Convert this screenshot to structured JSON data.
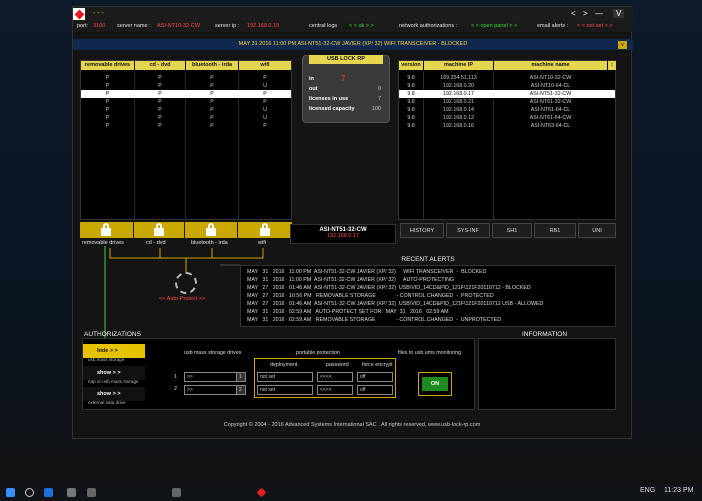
{
  "app": {
    "dots": "- - -",
    "nav_left": "<",
    "nav_right": ">",
    "minimize": "—",
    "menu": "V"
  },
  "status": {
    "port_label": "port:",
    "port": "3100",
    "server_name_label": "server name :",
    "server_name": "ASI-NT10-32-CW",
    "server_ip_label": "server ip :",
    "server_ip": "192.168.0.19",
    "central_logs_label": "central logs",
    "central_logs_value": "< < ok > >",
    "network_auth_label": "network authorizations :",
    "network_auth_value": "< < open panel > >",
    "email_label": "email alerts :",
    "email_value": "< < not set > >"
  },
  "banner": {
    "text": "MAY   31   2016   11:00 PM   ASI-NT51-32-CW JAVIER (XP/ 32)   WIFI TRANSCEIVER  -  BLOCKED",
    "button": "v"
  },
  "devices": {
    "headers": [
      "removable drives",
      "cd - dvd",
      "bluetooth - irda",
      "wifi"
    ],
    "rows": [
      [
        "P",
        "P",
        "P",
        "P"
      ],
      [
        "P",
        "P",
        "P",
        "U"
      ],
      [
        "P",
        "P",
        "P",
        "P"
      ],
      [
        "P",
        "P",
        "P",
        "P"
      ],
      [
        "P",
        "P",
        "P",
        "U"
      ],
      [
        "P",
        "P",
        "P",
        "U"
      ],
      [
        "P",
        "P",
        "P",
        "P"
      ]
    ],
    "selected_row": 2,
    "lock_labels": [
      "removable drives",
      "cd - dvd",
      "bluetooth - irda",
      "wifi"
    ]
  },
  "usb_panel": {
    "title": "USB LOCK RP",
    "in_label": "in",
    "in_value": "7",
    "out_label": "out",
    "out_value": "0",
    "licenses_label": "licenses in use",
    "licenses_value": "7",
    "capacity_label": "licensed capacity",
    "capacity_value": "100"
  },
  "machines": {
    "headers": [
      "version",
      "machine IP",
      "machine name"
    ],
    "sort_icon": "↕",
    "rows": [
      [
        "9.8",
        "169.254.51.113",
        "ASI-NT10-32-CW"
      ],
      [
        "9.8",
        "192.168.0.20",
        "ASI-NT10-64-CL"
      ],
      [
        "9.8",
        "192.168.0.17",
        "ASI-NT51-32-CW"
      ],
      [
        "9.8",
        "192.168.0.21",
        "ASI-NT61-32-CW"
      ],
      [
        "9.8",
        "192.168.0.14",
        "ASI-NT61-64-CL"
      ],
      [
        "9.8",
        "192.168.0.12",
        "ASI-NT61-64-CW"
      ],
      [
        "9.8",
        "192.168.0.16",
        "ASI-NT63-64-CL"
      ]
    ],
    "selected_row": 2
  },
  "selected_machine": {
    "name": "ASI-NT51-32-CW",
    "ip": "192.168.0.17"
  },
  "tabs": [
    "HISTORY",
    "SYS-INF",
    "SH1",
    "RB1",
    "UNI"
  ],
  "auto_protect": "<< Auto-Protect >>",
  "alerts": {
    "title": "RECENT ALERTS",
    "rows": [
      "MAY   31   2016   11:00 PM  ASI-NT51-32-CW JAVIER (XP/ 32)     WIFI TRANSCEIVER  -  BLOCKED",
      "MAY   31   2016   11:00 PM  ASI-NT51-32-CW JAVIER (XP/ 32)     AUTO-PROTECTING",
      "MAY   27   2016   01:46 AM  ASI-NT51-32-CW JAVIER (XP/ 32)  USB\\VID_14CD&PID_121F\\121F20110712 - BLOCKED",
      "MAY   27   2016   10:56 PM   REMOVABLE STORAGE              - CONTROL CHANGED  -  PROTECTED",
      "MAY   27   2016   01:46 AM  ASI-NT51-32-CW JAVIER (XP/ 32)  USB\\VID_14CD&PID_121F\\121F20110712 USB - ALLOWED",
      "MAY   31   2016   02:59 AM   AUTO-PROTECT SET FOR:  MAY  31   2016   02:59 AM",
      "MAY   31   2016   02:59 AM   REMOVABLE STORAGE              - CONTROL CHANGED  -  UNPROTECTED"
    ]
  },
  "authorizations": {
    "title": "AUTHORIZATIONS",
    "side": [
      {
        "label": "hide > >",
        "sub": "usb mass storage"
      },
      {
        "label": "show > >",
        "sub": "mtp or usb mass storage"
      },
      {
        "label": "show > >",
        "sub": "external sata drive"
      }
    ],
    "usb_header": "usb mass storage drives",
    "portable_header": "portable protection",
    "files_header": "files to usb ums monitoring",
    "row_numbers": [
      "1",
      "2"
    ],
    "drive_cells": [
      [
        ">>",
        "1"
      ],
      [
        ">>",
        "2"
      ]
    ],
    "sub_headers": [
      "deployment",
      "password",
      "force encrypt"
    ],
    "protection_rows": [
      [
        "not set",
        "<<<<",
        "off"
      ],
      [
        "not set",
        "<<<<",
        "off"
      ]
    ],
    "on_button": "ON"
  },
  "information": {
    "title": "INFORMATION"
  },
  "footer": "Copyright © 2004 - 2016 Advanced Systems International SAC . All rights reserved, www.usb-lock-rp.com",
  "taskbar": {
    "lang": "ENG",
    "time": "11:23 PM"
  }
}
